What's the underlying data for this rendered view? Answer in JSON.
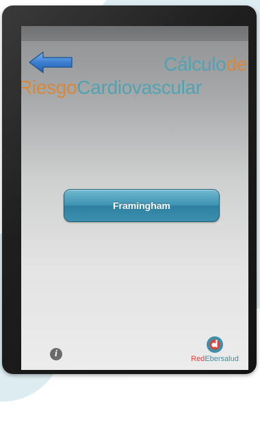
{
  "header": {
    "title_part1": "Cálculo",
    "title_part2": "de",
    "title_part3": "Riesgo",
    "title_part4": "Cardiovascular"
  },
  "main": {
    "button_label": "Framingham"
  },
  "footer": {
    "info_glyph": "i",
    "logo_text_part1": "Red",
    "logo_text_part2": "Ebersalud"
  },
  "icons": {
    "back": "back-arrow-icon",
    "info": "info-icon",
    "logo": "redebersalud-logo-icon"
  },
  "colors": {
    "title_blue": "#4fa3b3",
    "title_orange": "#d9883a",
    "button_blue": "#3f95b4",
    "logo_red": "#e0423a",
    "logo_teal": "#3f8fa8"
  }
}
